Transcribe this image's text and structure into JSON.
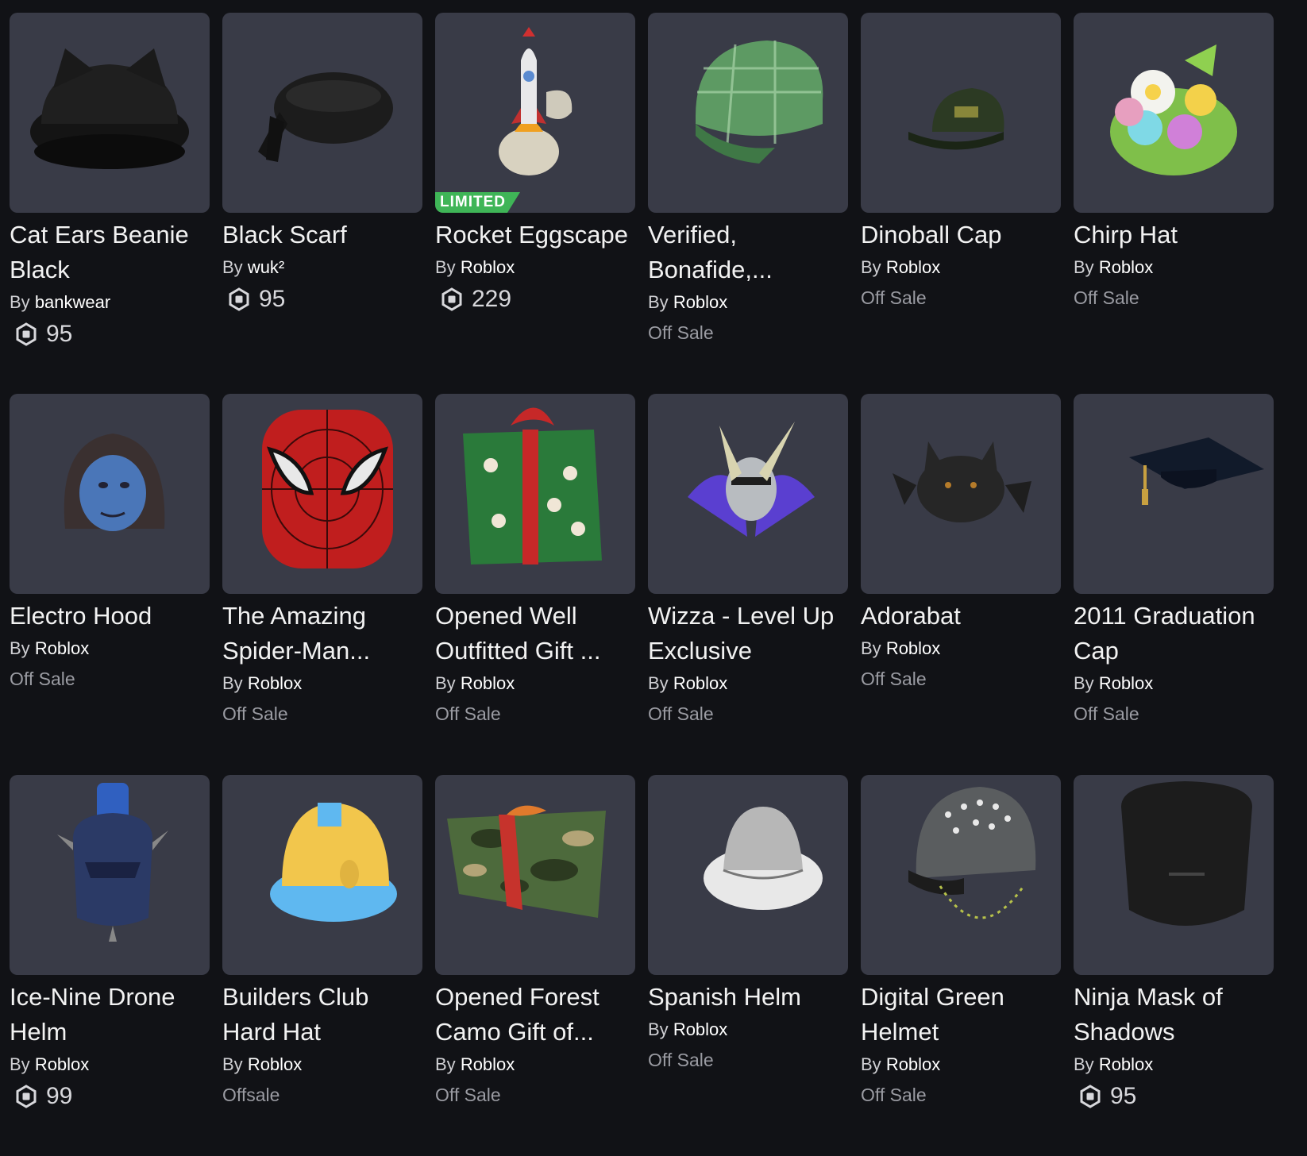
{
  "items": [
    {
      "name": "Cat Ears Beanie Black",
      "creator_prefix": "By",
      "creator": "bankwear",
      "price": "95",
      "status": "",
      "badge": "",
      "icon": "cat-ears-beanie-icon"
    },
    {
      "name": "Black Scarf",
      "creator_prefix": "By",
      "creator": "wuk²",
      "price": "95",
      "status": "",
      "badge": "",
      "icon": "black-scarf-icon"
    },
    {
      "name": "Rocket Eggscape",
      "creator_prefix": "By",
      "creator": "Roblox",
      "price": "229",
      "status": "",
      "badge": "LIMITED",
      "icon": "rocket-egg-icon"
    },
    {
      "name": "Verified, Bonafide,...",
      "creator_prefix": "By",
      "creator": "Roblox",
      "price": "",
      "status": "Off Sale",
      "badge": "",
      "icon": "plaid-cap-icon"
    },
    {
      "name": "Dinoball Cap",
      "creator_prefix": "By",
      "creator": "Roblox",
      "price": "",
      "status": "Off Sale",
      "badge": "",
      "icon": "dinoball-cap-icon"
    },
    {
      "name": "Chirp Hat",
      "creator_prefix": "By",
      "creator": "Roblox",
      "price": "",
      "status": "Off Sale",
      "badge": "",
      "icon": "chirp-hat-icon"
    },
    {
      "name": "Electro Hood",
      "creator_prefix": "By",
      "creator": "Roblox",
      "price": "",
      "status": "Off Sale",
      "badge": "",
      "icon": "electro-hood-icon"
    },
    {
      "name": "The Amazing Spider-Man...",
      "creator_prefix": "By",
      "creator": "Roblox",
      "price": "",
      "status": "Off Sale",
      "badge": "",
      "icon": "spider-man-mask-icon"
    },
    {
      "name": "Opened Well Outfitted Gift ...",
      "creator_prefix": "By",
      "creator": "Roblox",
      "price": "",
      "status": "Off Sale",
      "badge": "",
      "icon": "santa-gift-icon"
    },
    {
      "name": "Wizza - Level Up Exclusive",
      "creator_prefix": "By",
      "creator": "Roblox",
      "price": "",
      "status": "Off Sale",
      "badge": "",
      "icon": "wizza-head-icon"
    },
    {
      "name": "Adorabat",
      "creator_prefix": "By",
      "creator": "Roblox",
      "price": "",
      "status": "Off Sale",
      "badge": "",
      "icon": "adorabat-icon"
    },
    {
      "name": "2011 Graduation Cap",
      "creator_prefix": "By",
      "creator": "Roblox",
      "price": "",
      "status": "Off Sale",
      "badge": "",
      "icon": "graduation-cap-icon"
    },
    {
      "name": "Ice-Nine Drone Helm",
      "creator_prefix": "By",
      "creator": "Roblox",
      "price": "99",
      "status": "",
      "badge": "",
      "icon": "drone-helm-icon"
    },
    {
      "name": "Builders Club Hard Hat",
      "creator_prefix": "By",
      "creator": "Roblox",
      "price": "",
      "status": "Offsale",
      "badge": "",
      "icon": "hard-hat-icon"
    },
    {
      "name": "Opened Forest Camo Gift of...",
      "creator_prefix": "By",
      "creator": "Roblox",
      "price": "",
      "status": "Off Sale",
      "badge": "",
      "icon": "camo-gift-icon"
    },
    {
      "name": "Spanish Helm",
      "creator_prefix": "By",
      "creator": "Roblox",
      "price": "",
      "status": "Off Sale",
      "badge": "",
      "icon": "spanish-helm-icon"
    },
    {
      "name": "Digital Green Helmet",
      "creator_prefix": "By",
      "creator": "Roblox",
      "price": "",
      "status": "Off Sale",
      "badge": "",
      "icon": "green-helmet-icon"
    },
    {
      "name": "Ninja Mask of Shadows",
      "creator_prefix": "By",
      "creator": "Roblox",
      "price": "95",
      "status": "",
      "badge": "",
      "icon": "ninja-mask-icon"
    }
  ],
  "colors": {
    "background": "#111216",
    "tile": "#393b47",
    "limited_badge": "#3fb557",
    "text_primary": "#f2f2f2",
    "text_secondary": "#9a9ba2"
  }
}
